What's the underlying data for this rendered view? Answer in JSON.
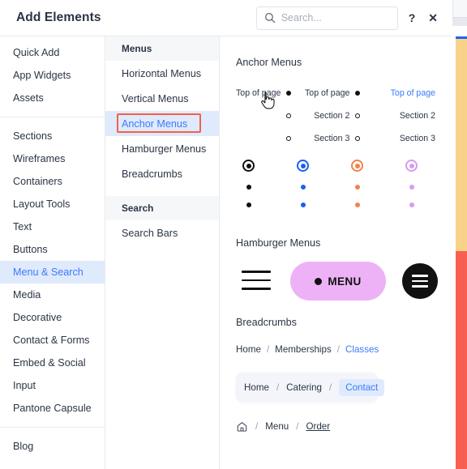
{
  "header": {
    "title": "Add Elements",
    "search_placeholder": "Search...",
    "search_value": "",
    "help_label": "?",
    "close_label": "✕"
  },
  "sidebar": {
    "group1": [
      {
        "label": "Quick Add"
      },
      {
        "label": "App Widgets"
      },
      {
        "label": "Assets"
      }
    ],
    "group2": [
      {
        "label": "Sections"
      },
      {
        "label": "Wireframes"
      },
      {
        "label": "Containers"
      },
      {
        "label": "Layout Tools"
      },
      {
        "label": "Text"
      },
      {
        "label": "Buttons"
      },
      {
        "label": "Menu & Search"
      },
      {
        "label": "Media"
      },
      {
        "label": "Decorative"
      },
      {
        "label": "Contact & Forms"
      },
      {
        "label": "Embed & Social"
      },
      {
        "label": "Input"
      },
      {
        "label": "Pantone Capsule"
      }
    ],
    "group3": [
      {
        "label": "Blog"
      }
    ],
    "active": "Menu & Search"
  },
  "subnav": {
    "sections": [
      {
        "heading": "Menus",
        "items": [
          {
            "label": "Horizontal Menus"
          },
          {
            "label": "Vertical Menus"
          },
          {
            "label": "Anchor Menus"
          },
          {
            "label": "Hamburger Menus"
          },
          {
            "label": "Breadcrumbs"
          }
        ]
      },
      {
        "heading": "Search",
        "items": [
          {
            "label": "Search Bars"
          }
        ]
      }
    ],
    "active": "Anchor Menus",
    "highlight_color": "#f4604a"
  },
  "main": {
    "anchor": {
      "title": "Anchor Menus",
      "variant1": {
        "rows": [
          {
            "label": "Top of page",
            "filled": true
          },
          {
            "label": "",
            "filled": false
          },
          {
            "label": "",
            "filled": false
          }
        ]
      },
      "variant2": {
        "rows": [
          {
            "label": "Top of page",
            "filled": true
          },
          {
            "label": "Section 2",
            "filled": false
          },
          {
            "label": "Section 3",
            "filled": false
          }
        ]
      },
      "variant3": {
        "rows": [
          {
            "label": "Top of page",
            "active": true
          },
          {
            "label": "Section 2",
            "active": false
          },
          {
            "label": "Section 3",
            "active": false
          }
        ]
      },
      "dot_columns": [
        {
          "color": "#111111"
        },
        {
          "color": "#1a5ff0"
        },
        {
          "color": "#f4814d"
        },
        {
          "color": "#d79bf0"
        }
      ]
    },
    "hamburger": {
      "title": "Hamburger Menus",
      "pill_label": "MENU",
      "pill_color": "#edb2f5",
      "circle_color": "#111111"
    },
    "breadcrumbs": {
      "title": "Breadcrumbs",
      "variant1": {
        "items": [
          "Home",
          "Memberships",
          "Classes"
        ],
        "separator": "/",
        "active": "Classes"
      },
      "variant2": {
        "items": [
          "Home",
          "Catering",
          "Contact"
        ],
        "separator": "/",
        "active": "Contact"
      },
      "variant3": {
        "home_icon": "home-icon",
        "items": [
          "Menu",
          "Order"
        ],
        "separator": "/",
        "underlined": "Order"
      }
    }
  },
  "strip": {
    "blue": "#1a66f0",
    "yellow": "#f9d28a",
    "red": "#f95f51"
  }
}
